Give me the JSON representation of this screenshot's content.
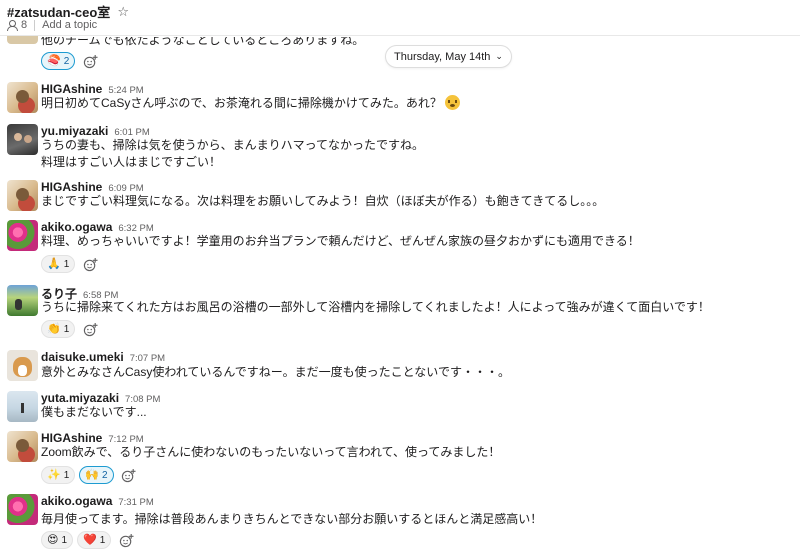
{
  "header": {
    "channel": "#zatsudan-ceo室",
    "members": "8",
    "topic": "Add a topic"
  },
  "date_divider": "Thursday, May 14th",
  "cut_message": {
    "text": "他のチームでも依たようなことしているところありますね。",
    "reactions": [
      {
        "emoji": "🍣",
        "count": "2",
        "mine": true
      }
    ]
  },
  "messages": [
    {
      "name": "HIGAshine",
      "time": "5:24 PM",
      "lines": [
        "明日初めてCaSyさん呼ぶので、お茶淹れる間に掃除機かけてみた。あれ？"
      ],
      "inline_emoji": "flushed-face",
      "avatar": "higashine"
    },
    {
      "name": "yu.miyazaki",
      "time": "6:01 PM",
      "lines": [
        "うちの妻も、掃除は気を使うから、まんまりハマってなかったですね。",
        "料理はすごい人はまじですごい！"
      ],
      "avatar": "yu-miyazaki"
    },
    {
      "name": "HIGAshine",
      "time": "6:09 PM",
      "lines": [
        "まじですごい料理気になる。次は料理をお願いしてみよう！自炊（ほぼ夫が作る）も飽きてきてるし。。。"
      ],
      "avatar": "higashine"
    },
    {
      "name": "akiko.ogawa",
      "time": "6:32 PM",
      "lines": [
        "料理、めっちゃいいですよ！学童用のお弁当プランで頼んだけど、ぜんぜん家族の昼夕おかずにも適用できる！"
      ],
      "avatar": "akiko-ogawa",
      "reactions": [
        {
          "emoji": "🙏",
          "count": "1",
          "mine": false
        }
      ]
    },
    {
      "name": "るり子",
      "time": "6:58 PM",
      "lines": [
        "うちに掃除来てくれた方はお風呂の浴槽の一部外して浴槽内を掃除してくれましたよ！人によって強みが違くて面白いです！"
      ],
      "avatar": "ruriko",
      "reactions": [
        {
          "emoji": "👏",
          "count": "1",
          "mine": false
        }
      ]
    },
    {
      "name": "daisuke.umeki",
      "time": "7:07 PM",
      "lines": [
        "意外とみなさんCasy使われているんですねー。まだ一度も使ったことないです・・・。"
      ],
      "avatar": "daisuke-umeki"
    },
    {
      "name": "yuta.miyazaki",
      "time": "7:08 PM",
      "lines": [
        "僕もまだないです..."
      ],
      "avatar": "yuta-miyazaki"
    },
    {
      "name": "HIGAshine",
      "time": "7:12 PM",
      "lines": [
        "Zoom飲みで、るり子さんに使わないのもったいないって言われて、使ってみました！"
      ],
      "avatar": "higashine",
      "reactions": [
        {
          "emoji": "✨",
          "count": "1",
          "mine": false
        },
        {
          "emoji": "🙌",
          "count": "2",
          "mine": true
        }
      ]
    },
    {
      "name": "akiko.ogawa",
      "time": "7:31 PM",
      "lines": [
        "毎月使ってます。掃除は普段あんまりきちんとできない部分お願いするとほんと満足感高い！"
      ],
      "avatar": "akiko-ogawa",
      "reactions": [
        {
          "emoji": "😍",
          "count": "1",
          "mine": false
        },
        {
          "emoji": "❤️",
          "count": "1",
          "mine": false
        }
      ]
    }
  ],
  "colors": {
    "accent": "#1264a3",
    "reaction_mine_border": "#1d9bd1",
    "text": "#1d1c1d",
    "muted": "#616061"
  }
}
